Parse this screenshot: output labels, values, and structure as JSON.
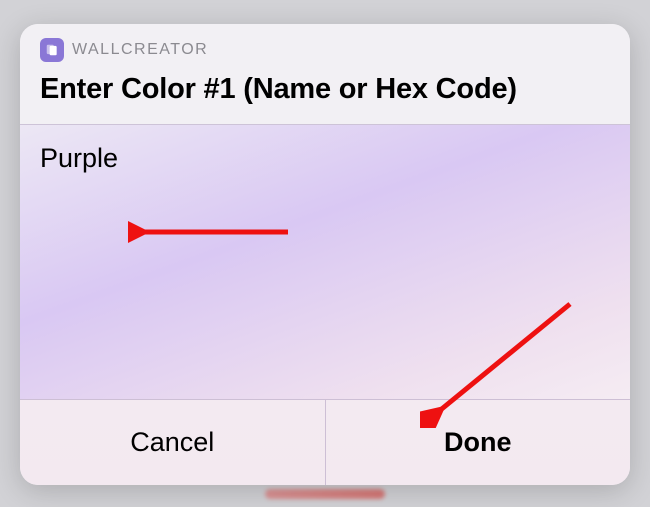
{
  "app": {
    "name": "WALLCREATOR",
    "accent_color": "#8a77d6"
  },
  "dialog": {
    "title": "Enter Color #1 (Name or Hex Code)",
    "input_value": "Purple",
    "cancel_label": "Cancel",
    "done_label": "Done"
  }
}
